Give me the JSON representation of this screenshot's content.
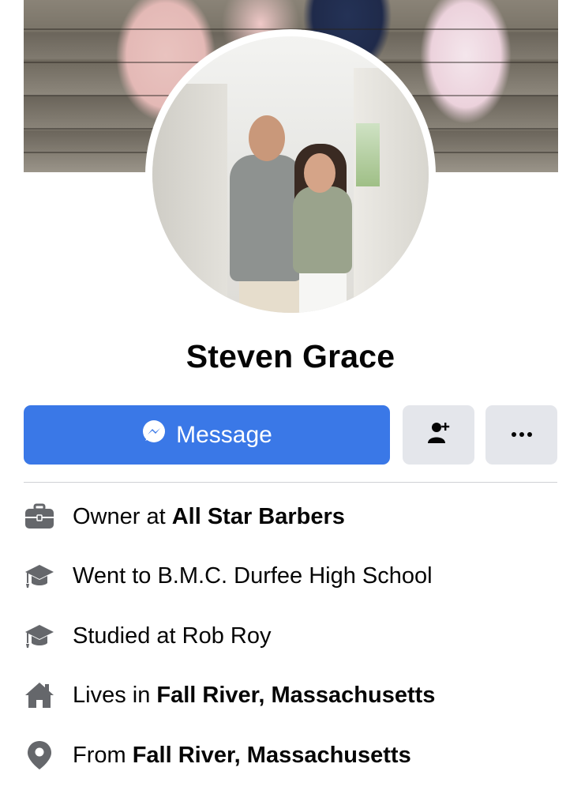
{
  "profile": {
    "name": "Steven Grace"
  },
  "actions": {
    "message_label": "Message"
  },
  "intro": [
    {
      "icon": "briefcase-icon",
      "prefix": "Owner at ",
      "bold": "All Star Barbers"
    },
    {
      "icon": "graduation-cap-icon",
      "prefix": "Went to B.M.C. Durfee High School",
      "bold": ""
    },
    {
      "icon": "graduation-cap-icon",
      "prefix": "Studied at Rob Roy",
      "bold": ""
    },
    {
      "icon": "home-icon",
      "prefix": "Lives in ",
      "bold": "Fall River, Massachusetts"
    },
    {
      "icon": "location-pin-icon",
      "prefix": "From ",
      "bold": "Fall River, Massachusetts"
    }
  ],
  "colors": {
    "accent": "#3a78e7",
    "secondary_button": "#e4e6eb",
    "icon_gray": "#65676b"
  }
}
